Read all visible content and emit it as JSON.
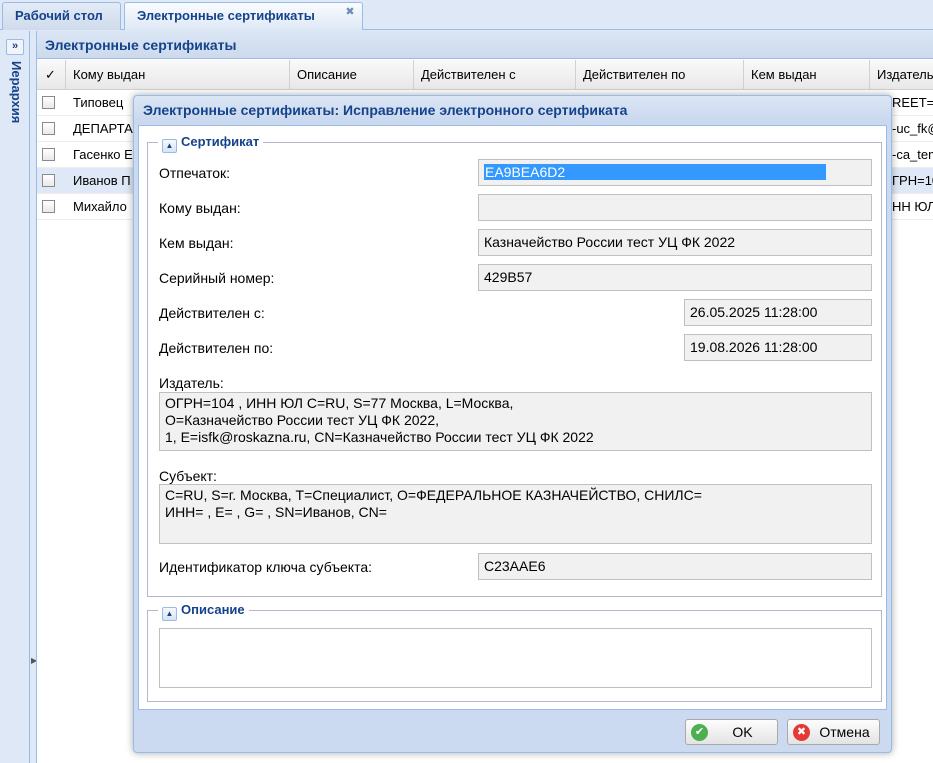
{
  "tabs": {
    "desktop": "Рабочий стол",
    "certificates": "Электронные сертификаты",
    "close_glyph": "✖"
  },
  "sidebar": {
    "expand_glyph": "»",
    "label": "Иерархия"
  },
  "panel": {
    "title": "Электронные сертификаты"
  },
  "grid": {
    "check_header": "✓",
    "columns": [
      "Кому выдан",
      "Описание",
      "Действителен с",
      "Действителен по",
      "Кем выдан",
      "Издатель"
    ],
    "rows": [
      {
        "issued_to": "Типовец",
        "issuer": "REET="
      },
      {
        "issued_to": "ДЕПАРТА",
        "issuer": "-uc_fk@"
      },
      {
        "issued_to": "Гасенко Е",
        "issuer": "-ca_tem"
      },
      {
        "issued_to": "Иванов П",
        "issuer": "ГРН=10"
      },
      {
        "issued_to": "Михайло",
        "issuer": "НН ЮЛ="
      }
    ]
  },
  "dialog": {
    "title": "Электронные сертификаты: Исправление электронного сертификата",
    "certificate_section": {
      "legend": "Сертификат",
      "toggle_glyph": "▲",
      "fields": {
        "thumbprint_label": "Отпечаток:",
        "thumbprint_value": "EA9BEA6D2",
        "issued_to_label": "Кому выдан:",
        "issued_to_value": "",
        "issued_by_label": "Кем выдан:",
        "issued_by_value": "Казначейство России тест УЦ ФК 2022",
        "serial_label": "Серийный номер:",
        "serial_value": "429B57",
        "valid_from_label": "Действителен с:",
        "valid_from_value": "26.05.2025 11:28:00",
        "valid_to_label": "Действителен по:",
        "valid_to_value": "19.08.2026 11:28:00",
        "issuer_label": "Издатель:",
        "issuer_line1": "ОГРН=104 , ИНН ЮЛ C=RU, S=77 Москва, L=Москва,",
        "issuer_line2": "O=Казначейство России тест УЦ ФК 2022,",
        "issuer_line3": "1, E=isfk@roskazna.ru, CN=Казначейство России тест УЦ ФК 2022",
        "subject_label": "Субъект:",
        "subject_line1": "C=RU, S=г. Москва, T=Специалист, O=ФЕДЕРАЛЬНОЕ КАЗНАЧЕЙСТВО, СНИЛС=",
        "subject_line2": "ИНН= , E= , G= , SN=Иванов, CN=",
        "ski_label": "Идентификатор ключа субъекта:",
        "ski_value": "C23AAE6"
      }
    },
    "description_section": {
      "legend": "Описание",
      "toggle_glyph": "▲",
      "value": ""
    },
    "buttons": {
      "ok_label": "OK",
      "ok_icon_glyph": "✔",
      "cancel_label": "Отмена",
      "cancel_icon_glyph": "✖"
    }
  },
  "colors": {
    "accent": "#15428b",
    "frame": "#99bbe8",
    "selection": "#3399ff",
    "ok_icon": "#4caf50",
    "cancel_icon": "#e53935"
  }
}
